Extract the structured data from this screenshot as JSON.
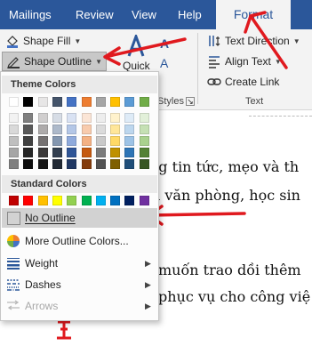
{
  "tabs": [
    {
      "label": "Mailings"
    },
    {
      "label": "Review"
    },
    {
      "label": "View"
    },
    {
      "label": "Help"
    },
    {
      "label": "Format"
    }
  ],
  "ribbon": {
    "shape_fill": "Shape Fill",
    "shape_outline": "Shape Outline",
    "quick_styles_partial": "Quick",
    "styles_group_partial": "Styles",
    "text_direction": "Text Direction",
    "align_text": "Align Text",
    "create_link": "Create Link",
    "text_group": "Text"
  },
  "menu": {
    "theme_colors_header": "Theme Colors",
    "standard_colors_header": "Standard Colors",
    "theme_top_row": [
      "#ffffff",
      "#000000",
      "#e7e6e6",
      "#44546a",
      "#4472c4",
      "#ed7d31",
      "#a5a5a5",
      "#ffc000",
      "#5b9bd5",
      "#70ad47"
    ],
    "theme_shades": [
      [
        "#f2f2f2",
        "#7f7f7f",
        "#d0cece",
        "#d6dce5",
        "#d9e2f3",
        "#fbe5d6",
        "#ededed",
        "#fff2cc",
        "#deebf7",
        "#e2f0d9"
      ],
      [
        "#d9d9d9",
        "#595959",
        "#aeabab",
        "#adb9ca",
        "#b4c7e7",
        "#f8cbad",
        "#dbdbdb",
        "#ffe699",
        "#bdd7ee",
        "#c5e0b4"
      ],
      [
        "#bfbfbf",
        "#404040",
        "#757171",
        "#8497b0",
        "#8faadc",
        "#f4b183",
        "#c9c9c9",
        "#ffd966",
        "#9dc3e6",
        "#a9d18e"
      ],
      [
        "#a6a6a6",
        "#262626",
        "#3a3838",
        "#333f50",
        "#2f5597",
        "#c55a11",
        "#7b7b7b",
        "#bf9000",
        "#2e75b6",
        "#548235"
      ],
      [
        "#808080",
        "#0d0d0d",
        "#171717",
        "#222a35",
        "#203864",
        "#843c0c",
        "#525252",
        "#7f6000",
        "#1f4e79",
        "#375623"
      ]
    ],
    "standard": [
      "#c00000",
      "#ff0000",
      "#ffc000",
      "#ffff00",
      "#92d050",
      "#00b050",
      "#00b0f0",
      "#0070c0",
      "#002060",
      "#7030a0"
    ],
    "no_outline": "No Outline",
    "more_colors": "More Outline Colors...",
    "weight": "Weight",
    "dashes": "Dashes",
    "arrows": "Arrows"
  },
  "document": {
    "line1": "ng tin tức, mẹo và th",
    "line2": "n văn phòng, học sin",
    "line3": "muốn trao dồi thêm",
    "line4": "phục vụ cho công việ"
  },
  "colors": {
    "ribbon_blue": "#2b579a",
    "annotation_red": "#e0191e"
  }
}
